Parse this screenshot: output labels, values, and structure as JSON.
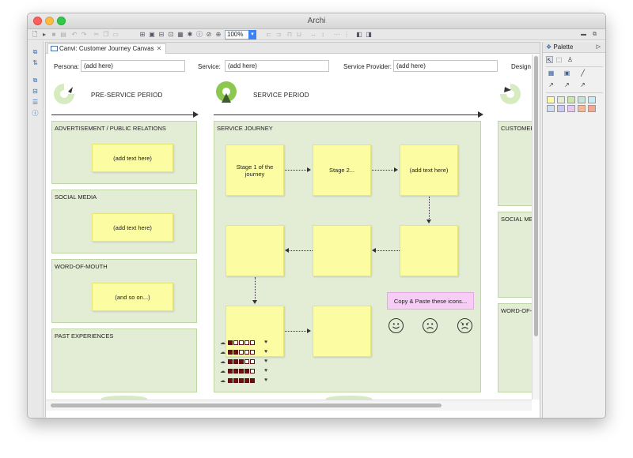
{
  "app": {
    "title": "Archi",
    "zoom": "100%"
  },
  "editor": {
    "tab_label": "Canvi: Customer Journey Canvas"
  },
  "header": {
    "persona_label": "Persona:",
    "persona_value": "(add here)",
    "service_label": "Service:",
    "service_value": "(add here)",
    "provider_label": "Service Provider:",
    "provider_value": "(add here)",
    "design_label": "Design"
  },
  "periods": {
    "pre": "PRE-SERVICE PERIOD",
    "service": "SERVICE PERIOD"
  },
  "pre_zones": [
    {
      "title": "ADVERTISEMENT / PUBLIC RELATIONS",
      "note": "(add text here)"
    },
    {
      "title": "SOCIAL MEDIA",
      "note": "(add text here)"
    },
    {
      "title": "WORD-OF-MOUTH",
      "note": "(and so on...)"
    },
    {
      "title": "PAST EXPERIENCES",
      "note": ""
    }
  ],
  "journey": {
    "title": "SERVICE JOURNEY",
    "stages": [
      "Stage 1 of the journey",
      "Stage 2...",
      "(add text here)",
      "",
      "",
      "",
      "",
      ""
    ],
    "icons_note": "Copy & Paste these icons...",
    "ratings": [
      1,
      2,
      3,
      4,
      5
    ]
  },
  "post_zones": [
    {
      "title": "CUSTOMER F"
    },
    {
      "title": "SOCIAL MED"
    },
    {
      "title": "WORD-OF-M"
    }
  ],
  "palette": {
    "title": "Palette",
    "swatch_colors": [
      "#fcfca2",
      "#e3ecd5",
      "#c8e8a8",
      "#bfe8d4",
      "#c8ecf5",
      "#d0dcf0",
      "#c8c8f0",
      "#e6c8f0",
      "#f5b894",
      "#f0a890"
    ]
  },
  "colors": {
    "zone_fill": "#e3ecd5",
    "sticky": "#fcfca2",
    "pink_note": "#f5cdf5",
    "rating_fill": "#6b0f0f",
    "period_icon": "#8cc850"
  }
}
